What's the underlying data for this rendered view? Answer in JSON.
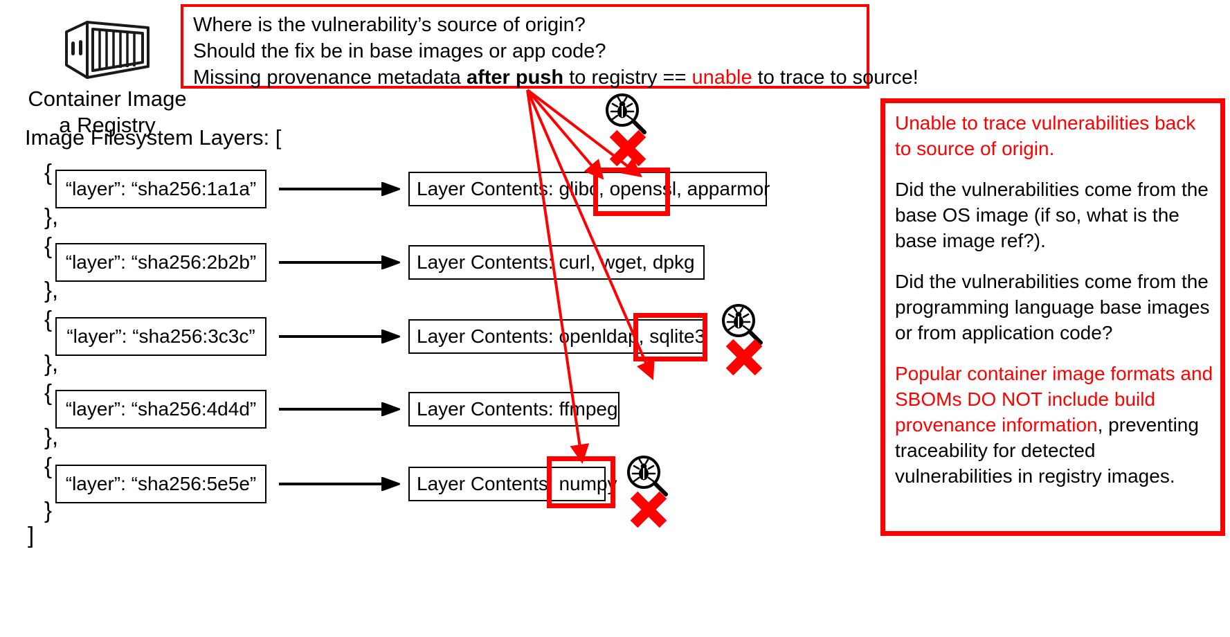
{
  "diagram": {
    "container": {
      "icon": "container-image-icon",
      "caption": "Container Image\na Registry"
    },
    "top_callout": {
      "line1": "Where is the vulnerability’s source of origin?",
      "line2": "Should the fix be in base images or app code?",
      "line3_a": "Missing provenance metadata ",
      "line3_bold": "after push",
      "line3_b": " to registry == ",
      "line3_red": "unable",
      "line3_c": " to trace to source!",
      "border_color": "#FF0000"
    },
    "layers_heading": "Image Filesystem Layers: [",
    "closing_bracket": "]",
    "open_brace": "{",
    "close_brace": "},",
    "close_brace_last": "}",
    "layers": [
      {
        "id_label": "“layer”: “sha256:1a1a”",
        "contents_label": "Layer Contents: glibc, openssl, apparmor",
        "highlighted_package": "openssl",
        "has_vuln": true
      },
      {
        "id_label": "“layer”: “sha256:2b2b”",
        "contents_label": "Layer Contents: curl, wget, dpkg",
        "highlighted_package": "",
        "has_vuln": false
      },
      {
        "id_label": "“layer”: “sha256:3c3c”",
        "contents_label": "Layer Contents: openldap, sqlite3",
        "highlighted_package": "sqlite3",
        "has_vuln": true
      },
      {
        "id_label": "“layer”: “sha256:4d4d”",
        "contents_label": "Layer Contents: ffmpeg",
        "highlighted_package": "",
        "has_vuln": false
      },
      {
        "id_label": "“layer”: “sha256:5e5e”",
        "contents_label": "Layer Contents: numpy",
        "highlighted_package": "numpy",
        "has_vuln": true
      }
    ],
    "right_panel": {
      "border_color": "#FF0000",
      "p1_red": "Unable to trace vulnerabilities back to source of origin.",
      "p2": "Did the vulnerabilities come from the base OS image (if so, what is the base image ref?).",
      "p3": "Did the vulnerabilities come from the programming language base images or from application code?",
      "p4_red": "Popular container image formats and SBOMs DO NOT include build provenance information",
      "p4_black": ", preventing traceability for detected vulnerabilities in registry images."
    },
    "icon_names": {
      "bug_scan": "bug-magnifier-icon",
      "x_mark": "red-x-icon",
      "arrow": "right-arrow-icon"
    }
  }
}
